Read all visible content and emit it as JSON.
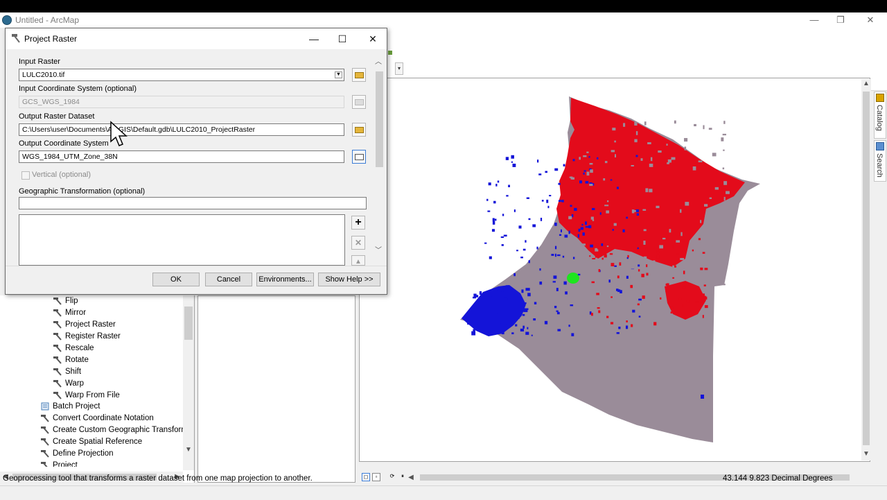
{
  "window": {
    "title": "Untitled - ArcMap",
    "minimize": "—",
    "restore": "❐",
    "close": "✕"
  },
  "dialog": {
    "title": "Project Raster",
    "minimize": "—",
    "maximize": "☐",
    "close": "✕",
    "input_raster": {
      "label": "Input Raster",
      "value": "LULC2010.tif"
    },
    "input_cs": {
      "label": "Input Coordinate System (optional)",
      "value": "GCS_WGS_1984"
    },
    "output_raster": {
      "label": "Output Raster Dataset",
      "value": "C:\\Users\\user\\Documents\\ArcGIS\\Default.gdb\\LULC2010_ProjectRaster"
    },
    "output_cs": {
      "label": "Output Coordinate System",
      "value": "WGS_1984_UTM_Zone_38N"
    },
    "vertical": {
      "label": "Vertical (optional)",
      "checked": false
    },
    "geo_transform": {
      "label": "Geographic Transformation (optional)",
      "value": ""
    },
    "buttons": {
      "ok": "OK",
      "cancel": "Cancel",
      "environments": "Environments...",
      "help": "Show Help >>"
    }
  },
  "toolbox": {
    "items": [
      {
        "label": "Flip",
        "icon": "hammer-icon"
      },
      {
        "label": "Mirror",
        "icon": "hammer-icon"
      },
      {
        "label": "Project Raster",
        "icon": "hammer-icon"
      },
      {
        "label": "Register Raster",
        "icon": "hammer-icon"
      },
      {
        "label": "Rescale",
        "icon": "hammer-icon"
      },
      {
        "label": "Rotate",
        "icon": "hammer-icon"
      },
      {
        "label": "Shift",
        "icon": "hammer-icon"
      },
      {
        "label": "Warp",
        "icon": "hammer-icon"
      },
      {
        "label": "Warp From File",
        "icon": "hammer-icon"
      },
      {
        "label": "Batch Project",
        "icon": "script-icon"
      },
      {
        "label": "Convert Coordinate Notation",
        "icon": "hammer-icon"
      },
      {
        "label": "Create Custom Geographic Transform",
        "icon": "hammer-icon"
      },
      {
        "label": "Create Spatial Reference",
        "icon": "hammer-icon"
      },
      {
        "label": "Define Projection",
        "icon": "hammer-icon"
      },
      {
        "label": "Project",
        "icon": "hammer-icon"
      }
    ]
  },
  "side_tabs": {
    "catalog": "Catalog",
    "search": "Search"
  },
  "status": {
    "message": "Geoprocessing tool that transforms a raster dataset from one map projection to another.",
    "coords": "43.144  9.823 Decimal Degrees"
  },
  "map": {
    "colors": {
      "background": "#9a8c99",
      "urban": "#e30b1b",
      "water": "#1414d8",
      "vegetation": "#1ee51e"
    }
  }
}
